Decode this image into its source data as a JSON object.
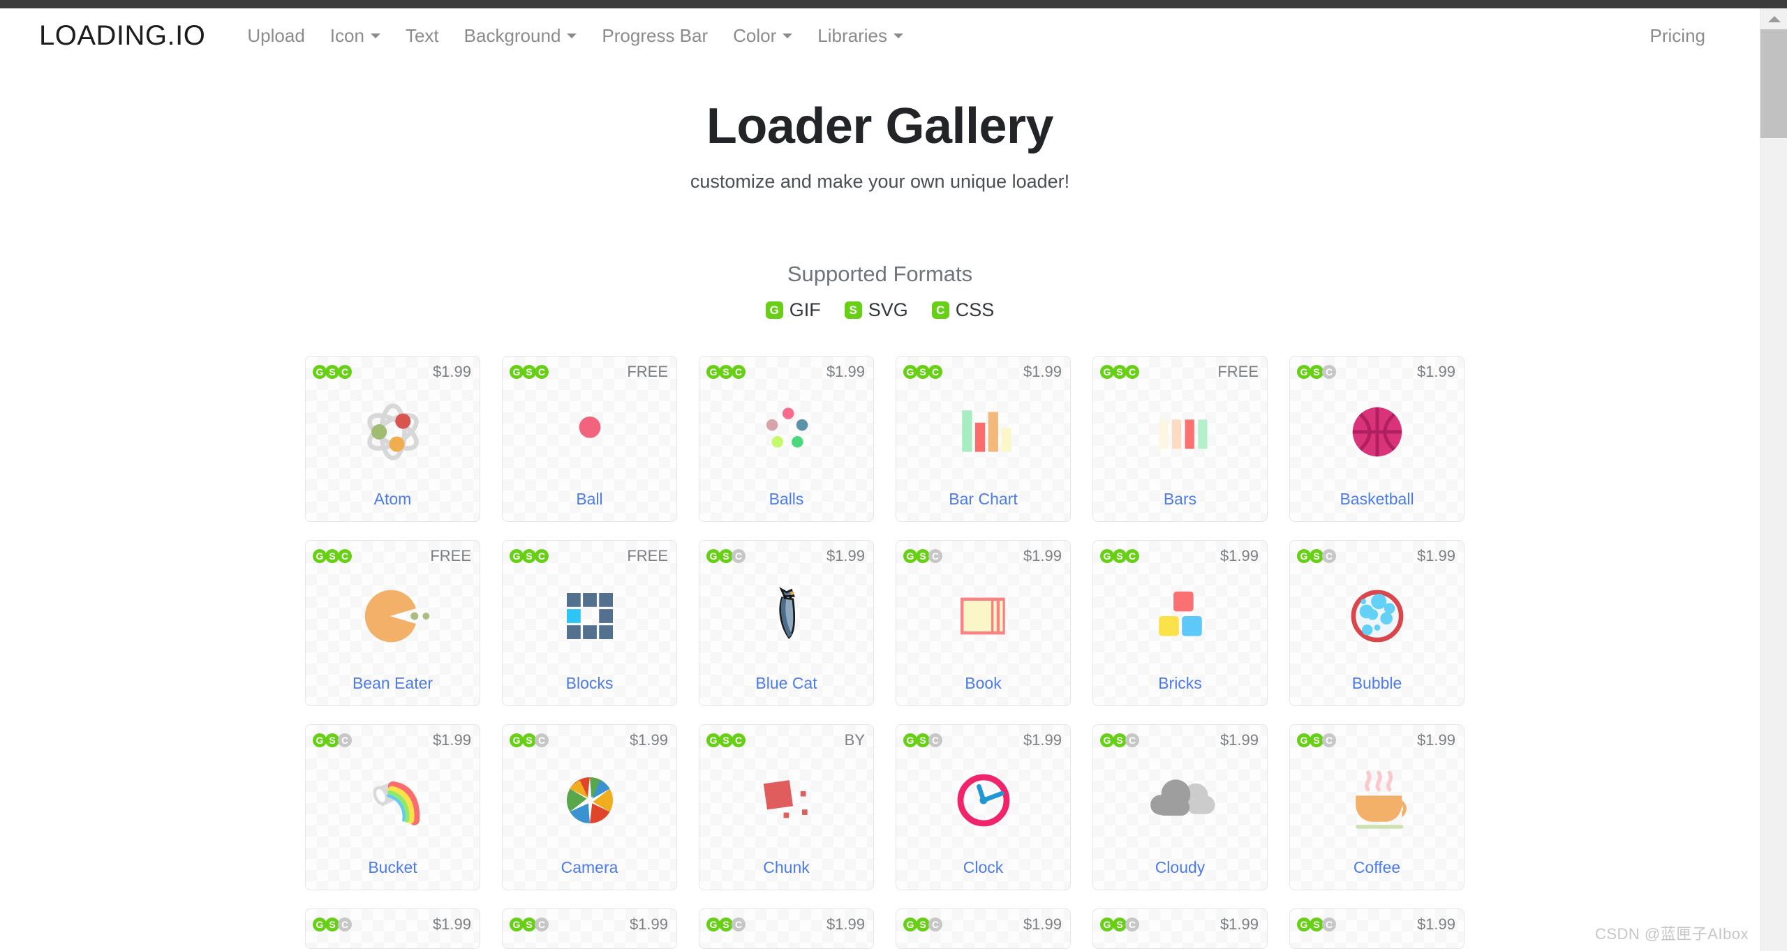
{
  "colors": {
    "brand_green": "#67d016",
    "badge_off": "#c7c7c7",
    "link_blue": "#4b7bec",
    "nav_text": "#8b8b8b",
    "heading": "#222428",
    "scrollbar_thumb": "#c1c1c1"
  },
  "navbar": {
    "brand": "LOADING.IO",
    "items": [
      {
        "label": "Upload",
        "has_caret": false
      },
      {
        "label": "Icon",
        "has_caret": true
      },
      {
        "label": "Text",
        "has_caret": false
      },
      {
        "label": "Background",
        "has_caret": true
      },
      {
        "label": "Progress Bar",
        "has_caret": false
      },
      {
        "label": "Color",
        "has_caret": true
      },
      {
        "label": "Libraries",
        "has_caret": true
      }
    ],
    "right_item": {
      "label": "Pricing"
    }
  },
  "hero": {
    "title": "Loader Gallery",
    "subtitle": "customize and make your own unique loader!"
  },
  "formats": {
    "title": "Supported Formats",
    "badges": [
      {
        "letter": "G",
        "label": "GIF"
      },
      {
        "letter": "S",
        "label": "SVG"
      },
      {
        "letter": "C",
        "label": "CSS"
      }
    ]
  },
  "gallery": {
    "cards": [
      {
        "name": "Atom",
        "price": "$1.99",
        "formats": [
          "G",
          "S",
          "C"
        ],
        "enabled": [
          true,
          true,
          true
        ],
        "icon": "atom-icon"
      },
      {
        "name": "Ball",
        "price": "FREE",
        "formats": [
          "G",
          "S",
          "C"
        ],
        "enabled": [
          true,
          true,
          true
        ],
        "icon": "ball-icon"
      },
      {
        "name": "Balls",
        "price": "$1.99",
        "formats": [
          "G",
          "S",
          "C"
        ],
        "enabled": [
          true,
          true,
          true
        ],
        "icon": "balls-icon"
      },
      {
        "name": "Bar Chart",
        "price": "$1.99",
        "formats": [
          "G",
          "S",
          "C"
        ],
        "enabled": [
          true,
          true,
          true
        ],
        "icon": "bar-chart-icon"
      },
      {
        "name": "Bars",
        "price": "FREE",
        "formats": [
          "G",
          "S",
          "C"
        ],
        "enabled": [
          true,
          true,
          true
        ],
        "icon": "bars-icon"
      },
      {
        "name": "Basketball",
        "price": "$1.99",
        "formats": [
          "G",
          "S",
          "C"
        ],
        "enabled": [
          true,
          true,
          false
        ],
        "icon": "basketball-icon"
      },
      {
        "name": "Bean Eater",
        "price": "FREE",
        "formats": [
          "G",
          "S",
          "C"
        ],
        "enabled": [
          true,
          true,
          true
        ],
        "icon": "bean-eater-icon"
      },
      {
        "name": "Blocks",
        "price": "FREE",
        "formats": [
          "G",
          "S",
          "C"
        ],
        "enabled": [
          true,
          true,
          true
        ],
        "icon": "blocks-icon"
      },
      {
        "name": "Blue Cat",
        "price": "$1.99",
        "formats": [
          "G",
          "S",
          "C"
        ],
        "enabled": [
          true,
          true,
          false
        ],
        "icon": "blue-cat-icon"
      },
      {
        "name": "Book",
        "price": "$1.99",
        "formats": [
          "G",
          "S",
          "C"
        ],
        "enabled": [
          true,
          true,
          false
        ],
        "icon": "book-icon"
      },
      {
        "name": "Bricks",
        "price": "$1.99",
        "formats": [
          "G",
          "S",
          "C"
        ],
        "enabled": [
          true,
          true,
          true
        ],
        "icon": "bricks-icon"
      },
      {
        "name": "Bubble",
        "price": "$1.99",
        "formats": [
          "G",
          "S",
          "C"
        ],
        "enabled": [
          true,
          true,
          false
        ],
        "icon": "bubble-icon"
      },
      {
        "name": "Bucket",
        "price": "$1.99",
        "formats": [
          "G",
          "S",
          "C"
        ],
        "enabled": [
          true,
          true,
          false
        ],
        "icon": "bucket-icon"
      },
      {
        "name": "Camera",
        "price": "$1.99",
        "formats": [
          "G",
          "S",
          "C"
        ],
        "enabled": [
          true,
          true,
          false
        ],
        "icon": "camera-icon"
      },
      {
        "name": "Chunk",
        "price": "BY",
        "formats": [
          "G",
          "S",
          "C"
        ],
        "enabled": [
          true,
          true,
          true
        ],
        "icon": "chunk-icon"
      },
      {
        "name": "Clock",
        "price": "$1.99",
        "formats": [
          "G",
          "S",
          "C"
        ],
        "enabled": [
          true,
          true,
          false
        ],
        "icon": "clock-icon"
      },
      {
        "name": "Cloudy",
        "price": "$1.99",
        "formats": [
          "G",
          "S",
          "C"
        ],
        "enabled": [
          true,
          true,
          false
        ],
        "icon": "cloudy-icon"
      },
      {
        "name": "Coffee",
        "price": "$1.99",
        "formats": [
          "G",
          "S",
          "C"
        ],
        "enabled": [
          true,
          true,
          false
        ],
        "icon": "coffee-icon"
      }
    ],
    "partial_row": [
      {
        "price": "$1.99",
        "formats": [
          "G",
          "S",
          "C"
        ],
        "enabled": [
          true,
          true,
          false
        ]
      },
      {
        "price": "$1.99",
        "formats": [
          "G",
          "S",
          "C"
        ],
        "enabled": [
          true,
          true,
          false
        ]
      },
      {
        "price": "$1.99",
        "formats": [
          "G",
          "S",
          "C"
        ],
        "enabled": [
          true,
          true,
          false
        ]
      },
      {
        "price": "$1.99",
        "formats": [
          "G",
          "S",
          "C"
        ],
        "enabled": [
          true,
          true,
          false
        ]
      },
      {
        "price": "$1.99",
        "formats": [
          "G",
          "S",
          "C"
        ],
        "enabled": [
          true,
          true,
          false
        ]
      },
      {
        "price": "$1.99",
        "formats": [
          "G",
          "S",
          "C"
        ],
        "enabled": [
          true,
          true,
          false
        ]
      }
    ]
  },
  "watermark": {
    "text": "CSDN @蓝匣子AIbox"
  }
}
